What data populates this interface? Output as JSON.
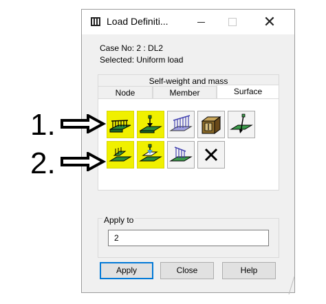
{
  "window": {
    "title": "Load Definiti..."
  },
  "info": {
    "case_no": "Case No: 2 : DL2",
    "selected": "Selected:     Uniform load"
  },
  "tabs": {
    "outer": "Self-weight and mass",
    "node": "Node",
    "member": "Member",
    "surface": "Surface",
    "active": "Surface"
  },
  "icons": {
    "row1": [
      "uniform-surface-load-icon",
      "surface-point-load-icon",
      "surface-linear-load-icon",
      "volume-load-icon",
      "surface-pressure-load-icon"
    ],
    "row2": [
      "uniform-load-on-contour-icon",
      "point-load-on-contour-icon",
      "linear-load-on-contour-icon",
      "delete-load-icon"
    ],
    "highlight_color": "#f0f000"
  },
  "apply_to": {
    "label": "Apply to",
    "value": "2"
  },
  "buttons": {
    "apply": "Apply",
    "close": "Close",
    "help": "Help"
  },
  "annotations": {
    "label1": "1.",
    "label2": "2."
  }
}
